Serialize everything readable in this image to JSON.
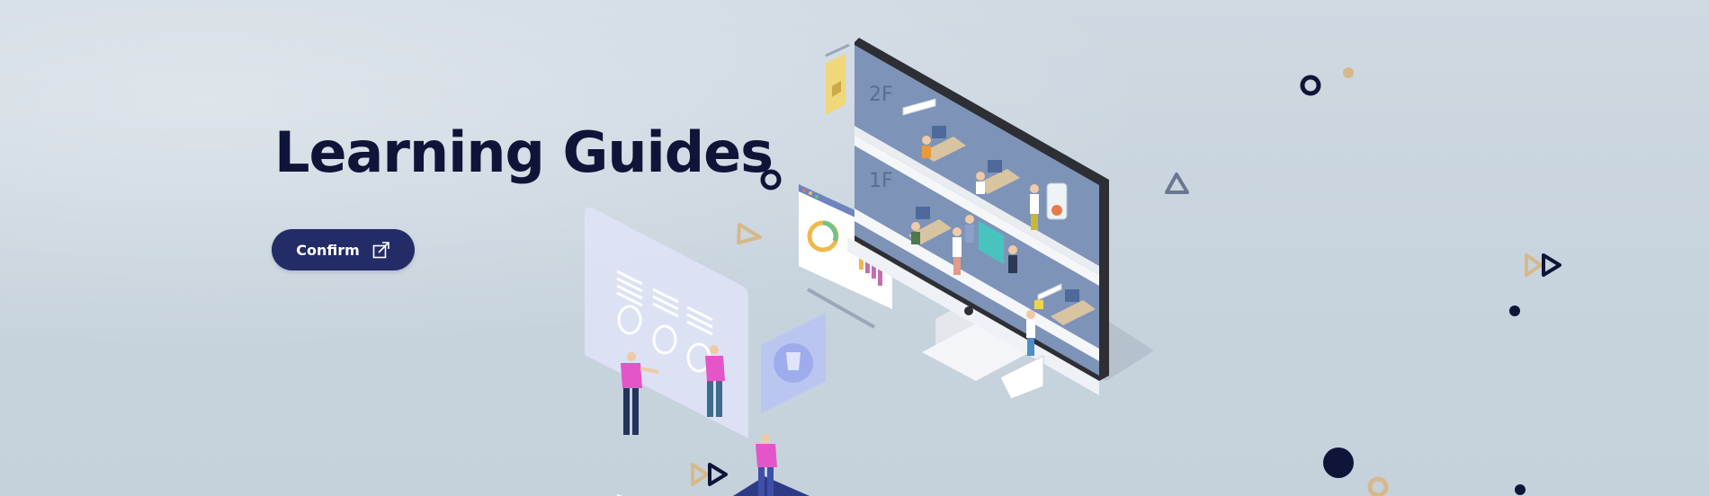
{
  "hero": {
    "title": "Learning Guides",
    "cta_label": "Confirm",
    "cta_icon": "external-link-icon"
  },
  "floor_labels": {
    "upper": "2F",
    "lower": "1F"
  },
  "colors": {
    "background": "#c9d5df",
    "title": "#0f1538",
    "button": "#232c66",
    "accent_navy": "#0f1538",
    "accent_gold": "#d6b98a",
    "accent_gray": "#6a7791",
    "accent_pink": "#e455c9",
    "accent_blue": "#5c7ab0"
  }
}
